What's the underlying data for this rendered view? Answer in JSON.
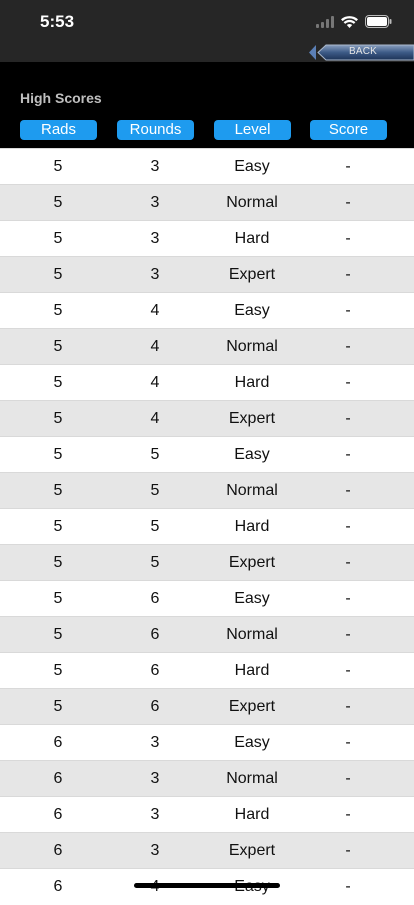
{
  "status": {
    "time": "5:53"
  },
  "nav": {
    "back_label": "BACK"
  },
  "page": {
    "title": "High Scores"
  },
  "colors": {
    "header_button": "#1e9bef",
    "alt_row": "#e6e6e6"
  },
  "icons": [
    "signal-icon",
    "wifi-icon",
    "battery-icon",
    "back-arrow-icon"
  ],
  "table": {
    "columns": [
      "Rads",
      "Rounds",
      "Level",
      "Score"
    ],
    "rows": [
      [
        "5",
        "3",
        "Easy",
        "-"
      ],
      [
        "5",
        "3",
        "Normal",
        "-"
      ],
      [
        "5",
        "3",
        "Hard",
        "-"
      ],
      [
        "5",
        "3",
        "Expert",
        "-"
      ],
      [
        "5",
        "4",
        "Easy",
        "-"
      ],
      [
        "5",
        "4",
        "Normal",
        "-"
      ],
      [
        "5",
        "4",
        "Hard",
        "-"
      ],
      [
        "5",
        "4",
        "Expert",
        "-"
      ],
      [
        "5",
        "5",
        "Easy",
        "-"
      ],
      [
        "5",
        "5",
        "Normal",
        "-"
      ],
      [
        "5",
        "5",
        "Hard",
        "-"
      ],
      [
        "5",
        "5",
        "Expert",
        "-"
      ],
      [
        "5",
        "6",
        "Easy",
        "-"
      ],
      [
        "5",
        "6",
        "Normal",
        "-"
      ],
      [
        "5",
        "6",
        "Hard",
        "-"
      ],
      [
        "5",
        "6",
        "Expert",
        "-"
      ],
      [
        "6",
        "3",
        "Easy",
        "-"
      ],
      [
        "6",
        "3",
        "Normal",
        "-"
      ],
      [
        "6",
        "3",
        "Hard",
        "-"
      ],
      [
        "6",
        "3",
        "Expert",
        "-"
      ],
      [
        "6",
        "4",
        "Easy",
        "-"
      ]
    ]
  }
}
